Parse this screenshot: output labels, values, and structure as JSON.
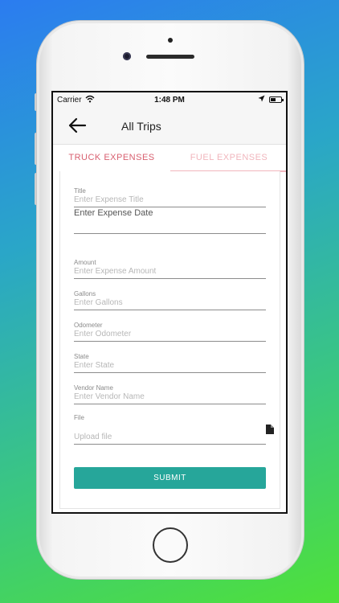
{
  "status_bar": {
    "carrier": "Carrier",
    "time": "1:48 PM"
  },
  "app_bar": {
    "title": "All Trips"
  },
  "tabs": [
    {
      "label": "TRUCK EXPENSES"
    },
    {
      "label": "FUEL EXPENSES"
    }
  ],
  "form": {
    "title": {
      "label": "Title",
      "placeholder": "Enter Expense Title"
    },
    "date": {
      "placeholder": "Enter Expense Date"
    },
    "amount": {
      "label": "Amount",
      "placeholder": "Enter Expense Amount"
    },
    "gallons": {
      "label": "Gallons",
      "placeholder": "Enter Gallons"
    },
    "odometer": {
      "label": "Odometer",
      "placeholder": "Enter Odometer"
    },
    "state": {
      "label": "State",
      "placeholder": "Enter State"
    },
    "vendor": {
      "label": "Vendor Name",
      "placeholder": "Enter Vendor Name"
    },
    "file": {
      "label": "File",
      "placeholder": "Upload file"
    },
    "submit_label": "SUBMIT"
  },
  "colors": {
    "accent": "#26a69a",
    "tab_active": "#d86070",
    "tab_inactive": "#f1b6bd"
  },
  "icons": [
    "wifi-icon",
    "location-arrow-icon",
    "battery-icon",
    "back-arrow-icon",
    "file-icon"
  ]
}
